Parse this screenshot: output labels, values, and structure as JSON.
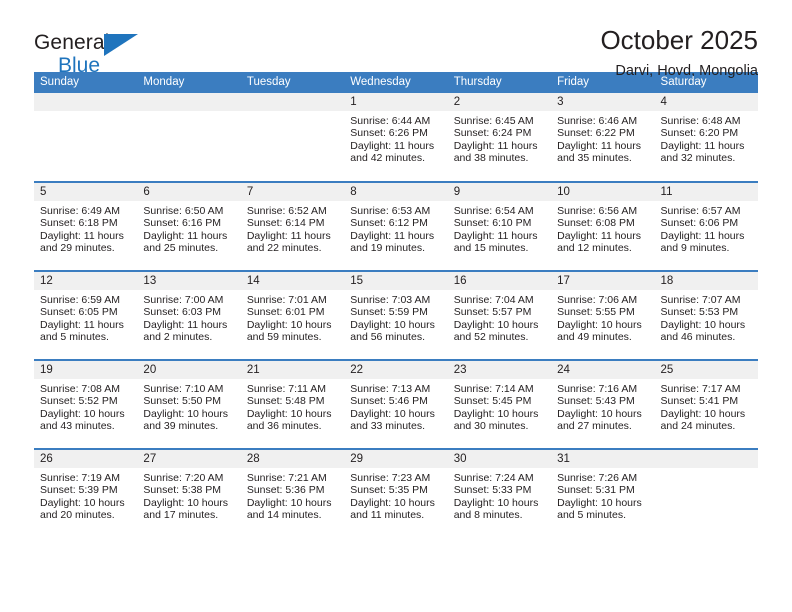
{
  "brand": {
    "line1": "General",
    "line2": "Blue",
    "accent_color": "#1f74bd"
  },
  "header": {
    "title": "October 2025",
    "location": "Darvi, Hovd, Mongolia"
  },
  "theme": {
    "header_bar_color": "#3b7dc0",
    "day_band_color": "#f0f0f0",
    "text_color": "#231f20"
  },
  "weekdays": [
    "Sunday",
    "Monday",
    "Tuesday",
    "Wednesday",
    "Thursday",
    "Friday",
    "Saturday"
  ],
  "weeks": [
    [
      {
        "empty": true
      },
      {
        "empty": true
      },
      {
        "empty": true
      },
      {
        "day": "1",
        "sunrise": "Sunrise: 6:44 AM",
        "sunset": "Sunset: 6:26 PM",
        "daylight1": "Daylight: 11 hours",
        "daylight2": "and 42 minutes."
      },
      {
        "day": "2",
        "sunrise": "Sunrise: 6:45 AM",
        "sunset": "Sunset: 6:24 PM",
        "daylight1": "Daylight: 11 hours",
        "daylight2": "and 38 minutes."
      },
      {
        "day": "3",
        "sunrise": "Sunrise: 6:46 AM",
        "sunset": "Sunset: 6:22 PM",
        "daylight1": "Daylight: 11 hours",
        "daylight2": "and 35 minutes."
      },
      {
        "day": "4",
        "sunrise": "Sunrise: 6:48 AM",
        "sunset": "Sunset: 6:20 PM",
        "daylight1": "Daylight: 11 hours",
        "daylight2": "and 32 minutes."
      }
    ],
    [
      {
        "day": "5",
        "sunrise": "Sunrise: 6:49 AM",
        "sunset": "Sunset: 6:18 PM",
        "daylight1": "Daylight: 11 hours",
        "daylight2": "and 29 minutes."
      },
      {
        "day": "6",
        "sunrise": "Sunrise: 6:50 AM",
        "sunset": "Sunset: 6:16 PM",
        "daylight1": "Daylight: 11 hours",
        "daylight2": "and 25 minutes."
      },
      {
        "day": "7",
        "sunrise": "Sunrise: 6:52 AM",
        "sunset": "Sunset: 6:14 PM",
        "daylight1": "Daylight: 11 hours",
        "daylight2": "and 22 minutes."
      },
      {
        "day": "8",
        "sunrise": "Sunrise: 6:53 AM",
        "sunset": "Sunset: 6:12 PM",
        "daylight1": "Daylight: 11 hours",
        "daylight2": "and 19 minutes."
      },
      {
        "day": "9",
        "sunrise": "Sunrise: 6:54 AM",
        "sunset": "Sunset: 6:10 PM",
        "daylight1": "Daylight: 11 hours",
        "daylight2": "and 15 minutes."
      },
      {
        "day": "10",
        "sunrise": "Sunrise: 6:56 AM",
        "sunset": "Sunset: 6:08 PM",
        "daylight1": "Daylight: 11 hours",
        "daylight2": "and 12 minutes."
      },
      {
        "day": "11",
        "sunrise": "Sunrise: 6:57 AM",
        "sunset": "Sunset: 6:06 PM",
        "daylight1": "Daylight: 11 hours",
        "daylight2": "and 9 minutes."
      }
    ],
    [
      {
        "day": "12",
        "sunrise": "Sunrise: 6:59 AM",
        "sunset": "Sunset: 6:05 PM",
        "daylight1": "Daylight: 11 hours",
        "daylight2": "and 5 minutes."
      },
      {
        "day": "13",
        "sunrise": "Sunrise: 7:00 AM",
        "sunset": "Sunset: 6:03 PM",
        "daylight1": "Daylight: 11 hours",
        "daylight2": "and 2 minutes."
      },
      {
        "day": "14",
        "sunrise": "Sunrise: 7:01 AM",
        "sunset": "Sunset: 6:01 PM",
        "daylight1": "Daylight: 10 hours",
        "daylight2": "and 59 minutes."
      },
      {
        "day": "15",
        "sunrise": "Sunrise: 7:03 AM",
        "sunset": "Sunset: 5:59 PM",
        "daylight1": "Daylight: 10 hours",
        "daylight2": "and 56 minutes."
      },
      {
        "day": "16",
        "sunrise": "Sunrise: 7:04 AM",
        "sunset": "Sunset: 5:57 PM",
        "daylight1": "Daylight: 10 hours",
        "daylight2": "and 52 minutes."
      },
      {
        "day": "17",
        "sunrise": "Sunrise: 7:06 AM",
        "sunset": "Sunset: 5:55 PM",
        "daylight1": "Daylight: 10 hours",
        "daylight2": "and 49 minutes."
      },
      {
        "day": "18",
        "sunrise": "Sunrise: 7:07 AM",
        "sunset": "Sunset: 5:53 PM",
        "daylight1": "Daylight: 10 hours",
        "daylight2": "and 46 minutes."
      }
    ],
    [
      {
        "day": "19",
        "sunrise": "Sunrise: 7:08 AM",
        "sunset": "Sunset: 5:52 PM",
        "daylight1": "Daylight: 10 hours",
        "daylight2": "and 43 minutes."
      },
      {
        "day": "20",
        "sunrise": "Sunrise: 7:10 AM",
        "sunset": "Sunset: 5:50 PM",
        "daylight1": "Daylight: 10 hours",
        "daylight2": "and 39 minutes."
      },
      {
        "day": "21",
        "sunrise": "Sunrise: 7:11 AM",
        "sunset": "Sunset: 5:48 PM",
        "daylight1": "Daylight: 10 hours",
        "daylight2": "and 36 minutes."
      },
      {
        "day": "22",
        "sunrise": "Sunrise: 7:13 AM",
        "sunset": "Sunset: 5:46 PM",
        "daylight1": "Daylight: 10 hours",
        "daylight2": "and 33 minutes."
      },
      {
        "day": "23",
        "sunrise": "Sunrise: 7:14 AM",
        "sunset": "Sunset: 5:45 PM",
        "daylight1": "Daylight: 10 hours",
        "daylight2": "and 30 minutes."
      },
      {
        "day": "24",
        "sunrise": "Sunrise: 7:16 AM",
        "sunset": "Sunset: 5:43 PM",
        "daylight1": "Daylight: 10 hours",
        "daylight2": "and 27 minutes."
      },
      {
        "day": "25",
        "sunrise": "Sunrise: 7:17 AM",
        "sunset": "Sunset: 5:41 PM",
        "daylight1": "Daylight: 10 hours",
        "daylight2": "and 24 minutes."
      }
    ],
    [
      {
        "day": "26",
        "sunrise": "Sunrise: 7:19 AM",
        "sunset": "Sunset: 5:39 PM",
        "daylight1": "Daylight: 10 hours",
        "daylight2": "and 20 minutes."
      },
      {
        "day": "27",
        "sunrise": "Sunrise: 7:20 AM",
        "sunset": "Sunset: 5:38 PM",
        "daylight1": "Daylight: 10 hours",
        "daylight2": "and 17 minutes."
      },
      {
        "day": "28",
        "sunrise": "Sunrise: 7:21 AM",
        "sunset": "Sunset: 5:36 PM",
        "daylight1": "Daylight: 10 hours",
        "daylight2": "and 14 minutes."
      },
      {
        "day": "29",
        "sunrise": "Sunrise: 7:23 AM",
        "sunset": "Sunset: 5:35 PM",
        "daylight1": "Daylight: 10 hours",
        "daylight2": "and 11 minutes."
      },
      {
        "day": "30",
        "sunrise": "Sunrise: 7:24 AM",
        "sunset": "Sunset: 5:33 PM",
        "daylight1": "Daylight: 10 hours",
        "daylight2": "and 8 minutes."
      },
      {
        "day": "31",
        "sunrise": "Sunrise: 7:26 AM",
        "sunset": "Sunset: 5:31 PM",
        "daylight1": "Daylight: 10 hours",
        "daylight2": "and 5 minutes."
      },
      {
        "empty": true
      }
    ]
  ]
}
